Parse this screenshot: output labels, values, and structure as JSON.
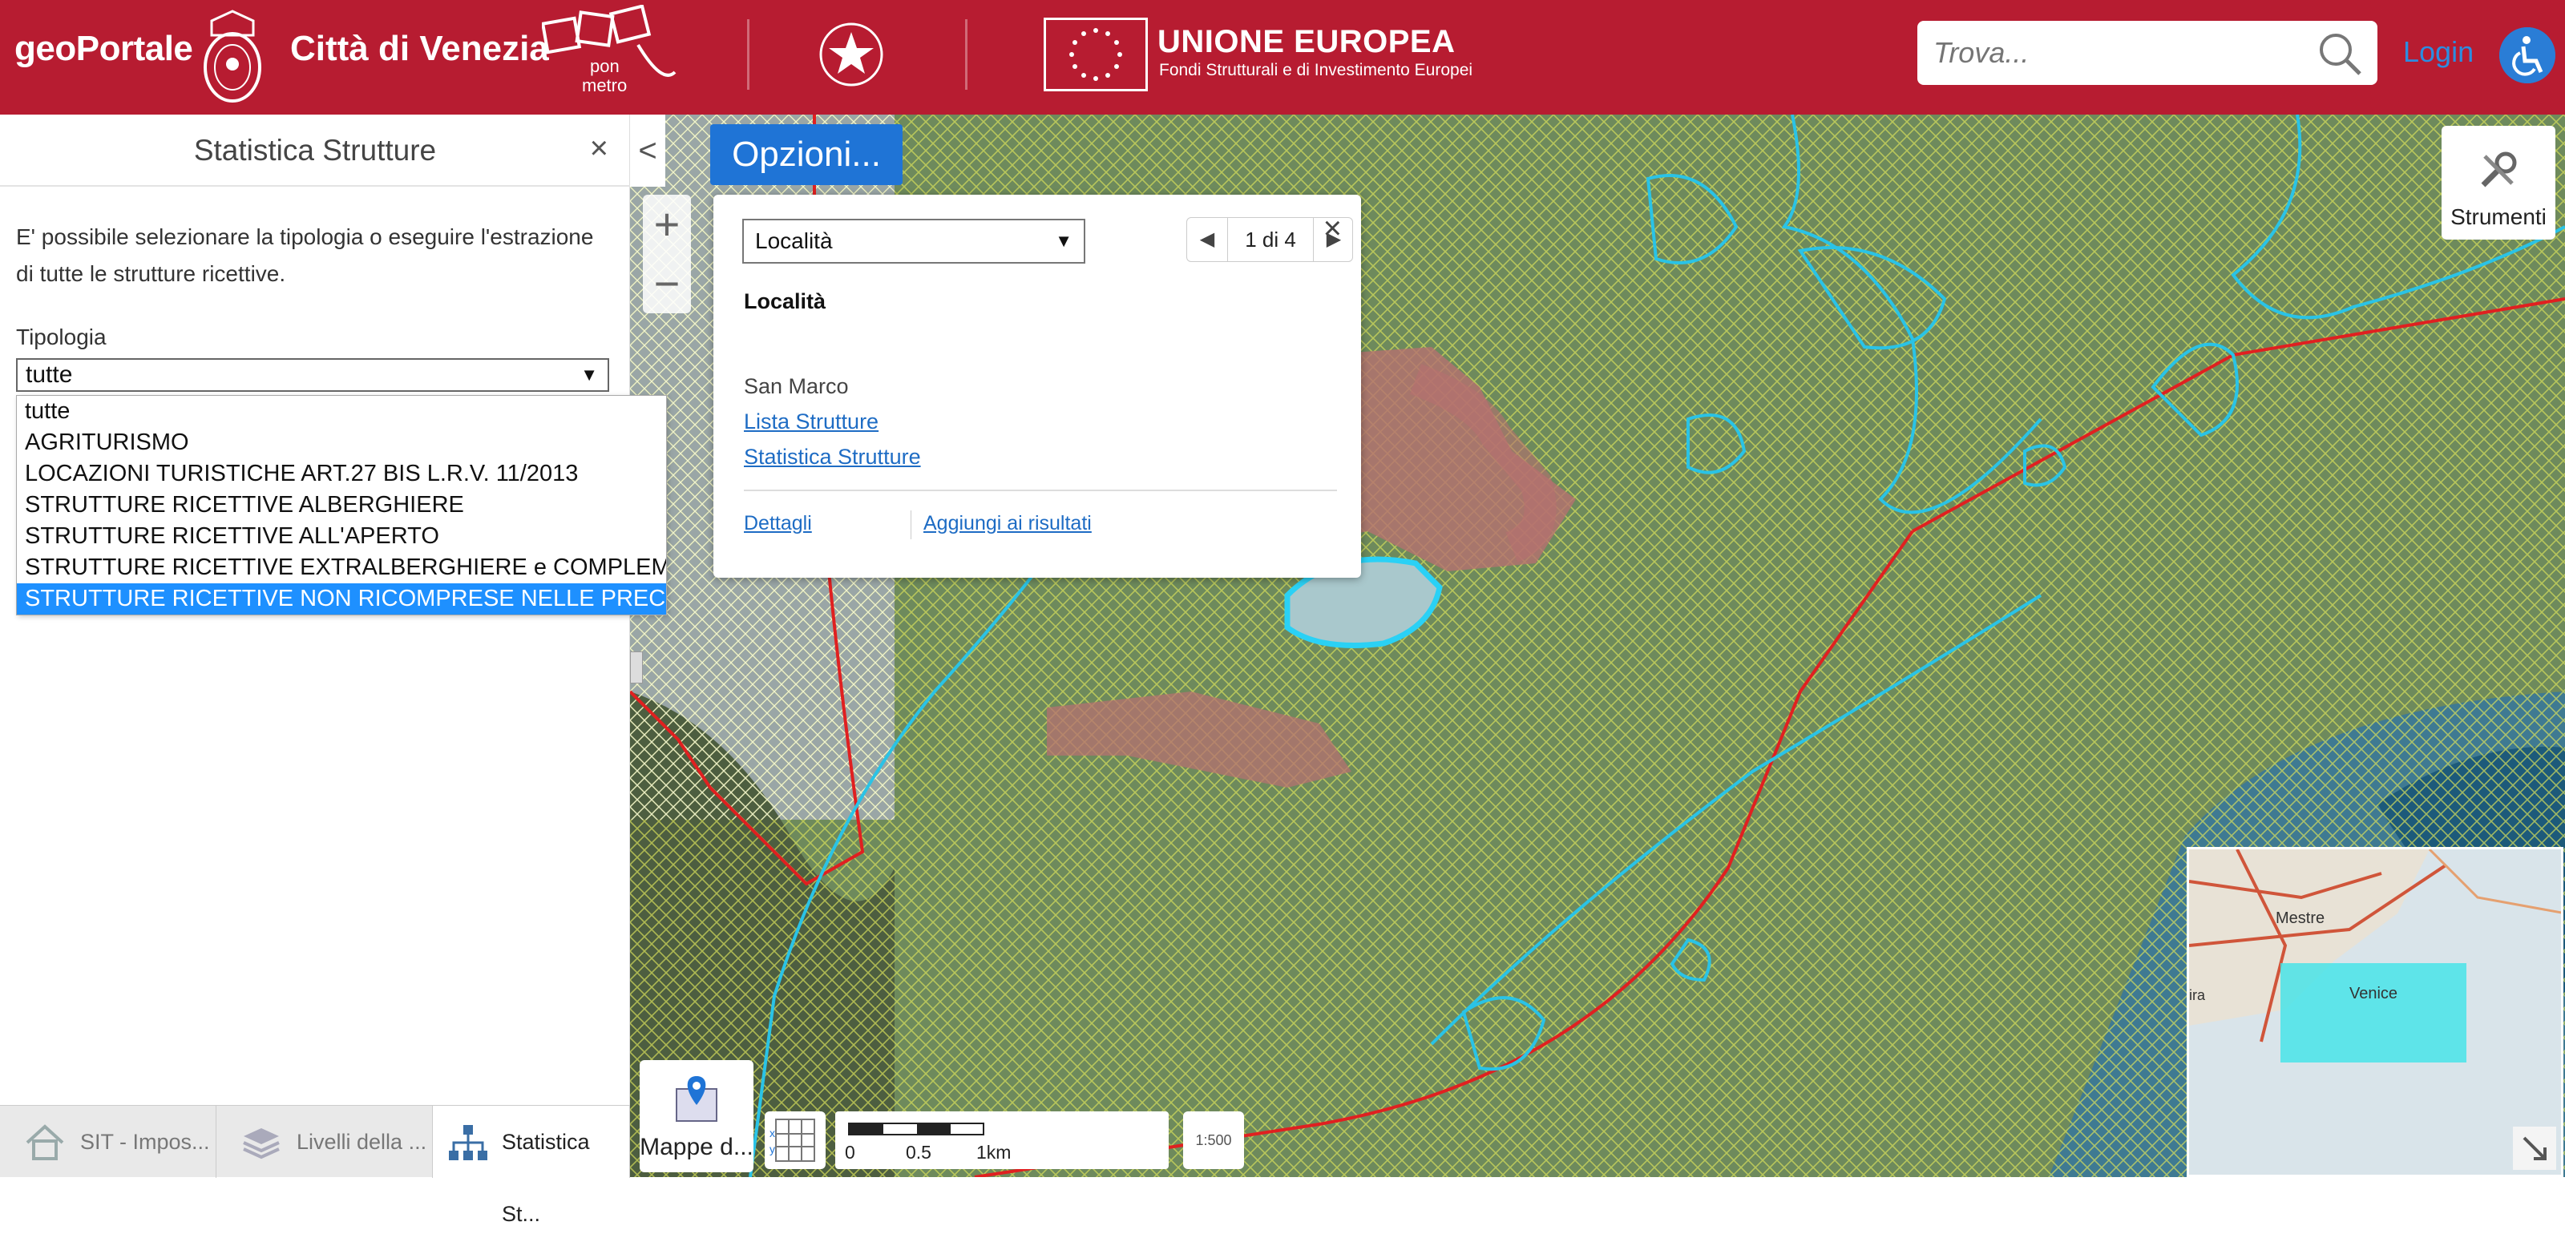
{
  "header": {
    "brand": "geoPortale",
    "city": "Città di Venezia",
    "pon": "pon",
    "metro": "metro",
    "eu_title": "UNIONE EUROPEA",
    "eu_subtitle": "Fondi Strutturali e di Investimento Europei",
    "search_placeholder": "Trova...",
    "login": "Login"
  },
  "sidebar": {
    "title": "Statistica Strutture",
    "close": "×",
    "description": "E' possibile selezionare la tipologia o eseguire l'estrazione di tutte le strutture ricettive.",
    "tipologia_label": "Tipologia",
    "selected": "tutte",
    "options": [
      "tutte",
      "AGRITURISMO",
      "LOCAZIONI TURISTICHE ART.27 BIS L.R.V. 11/2013",
      "STRUTTURE RICETTIVE ALBERGHIERE",
      "STRUTTURE RICETTIVE ALL'APERTO",
      "STRUTTURE RICETTIVE EXTRALBERGHIERE e COMPLEMENTARI",
      "STRUTTURE RICETTIVE NON RICOMPRESE NELLE PRECEDENTI"
    ],
    "highlighted_index": 6
  },
  "tabs": [
    {
      "label": "SIT - Impos..."
    },
    {
      "label": "Livelli della ..."
    },
    {
      "label": "Statistica St..."
    }
  ],
  "map": {
    "collapse": "<",
    "zoom_in": "+",
    "zoom_out": "−",
    "opzioni": "Opzioni...",
    "strumenti": "Strumenti",
    "mappe": "Mappe d...",
    "scale_ticks": [
      "0",
      "0.5",
      "1km"
    ],
    "scale_button": "1:500",
    "overview_labels": [
      "Mestre",
      "Venice",
      "ira"
    ]
  },
  "popup": {
    "select_value": "Località",
    "pager_text": "1 di 4",
    "close": "×",
    "title": "Località",
    "value": "San Marco",
    "links": [
      "Lista Strutture",
      "Statistica Strutture"
    ],
    "dettagli": "Dettagli",
    "aggiungi": "Aggiungi ai risultati"
  },
  "colors": {
    "header_bg": "#b71c31",
    "link": "#1e6cc4",
    "selected_option": "#1e90ff",
    "opzioni_bg": "#1f74d6"
  }
}
